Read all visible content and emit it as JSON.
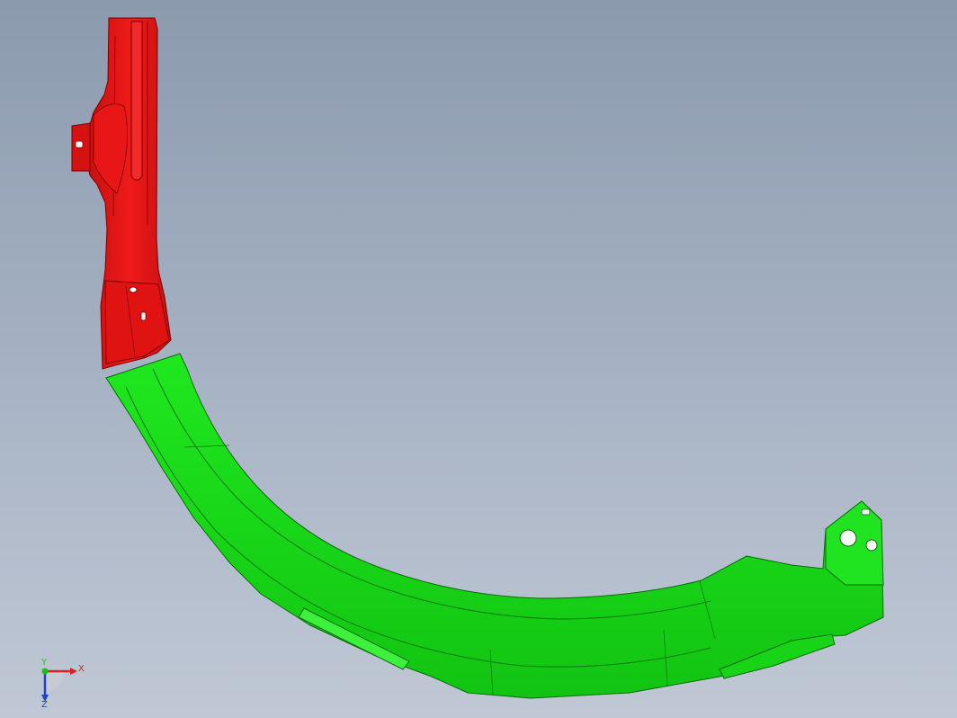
{
  "viewport": {
    "background_top": "#8c9aae",
    "background_bottom": "#c0c8d5"
  },
  "parts": [
    {
      "name": "upper-bracket",
      "color": "#e41414"
    },
    {
      "name": "lower-arc-member",
      "color": "#19e019"
    }
  ],
  "triad": {
    "x_label": "X",
    "y_label": "Y",
    "z_label": "Z",
    "x_color": "#e02020",
    "y_color": "#18c018",
    "z_color": "#2040d0"
  }
}
